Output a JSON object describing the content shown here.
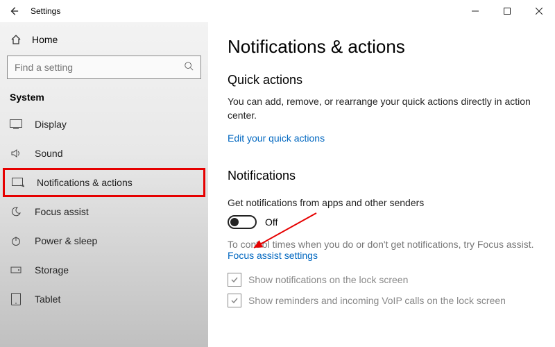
{
  "titlebar": {
    "title": "Settings"
  },
  "sidebar": {
    "home": "Home",
    "search_placeholder": "Find a setting",
    "heading": "System",
    "items": [
      {
        "label": "Display"
      },
      {
        "label": "Sound"
      },
      {
        "label": "Notifications & actions"
      },
      {
        "label": "Focus assist"
      },
      {
        "label": "Power & sleep"
      },
      {
        "label": "Storage"
      },
      {
        "label": "Tablet"
      }
    ]
  },
  "page": {
    "title": "Notifications & actions",
    "quick_actions_heading": "Quick actions",
    "quick_actions_body": "You can add, remove, or rearrange your quick actions directly in action center.",
    "edit_link": "Edit your quick actions",
    "notifications_heading": "Notifications",
    "notif_toggle_label": "Get notifications from apps and other senders",
    "toggle_state": "Off",
    "focus_help": "To control times when you do or don't get notifications, try Focus assist.",
    "focus_link": "Focus assist settings",
    "checks": [
      {
        "label": "Show notifications on the lock screen"
      },
      {
        "label": "Show reminders and incoming VoIP calls on the lock screen"
      }
    ]
  }
}
